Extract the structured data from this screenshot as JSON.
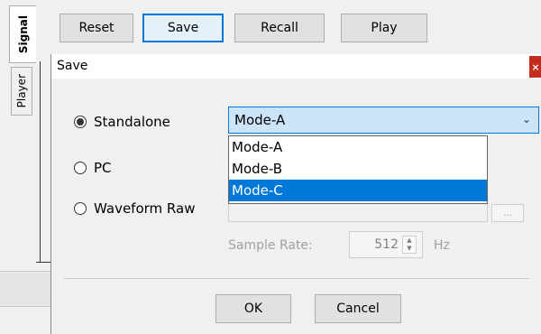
{
  "vertical_tabs": [
    {
      "label": "Signal"
    },
    {
      "label": "Player"
    }
  ],
  "toolbar": {
    "reset": "Reset",
    "save": "Save",
    "recall": "Recall",
    "play": "Play"
  },
  "dialog": {
    "title": "Save",
    "close": "×",
    "radios": {
      "standalone": "Standalone",
      "pc": "PC",
      "waveform_raw": "Waveform Raw"
    },
    "selected_radio": "standalone",
    "mode_select": {
      "value": "Mode-A",
      "options": [
        "Mode-A",
        "Mode-B",
        "Mode-C"
      ],
      "highlighted": "Mode-C"
    },
    "browse": "...",
    "sample_rate": {
      "label": "Sample Rate:",
      "value": "512",
      "unit": "Hz"
    },
    "ok": "OK",
    "cancel": "Cancel"
  }
}
